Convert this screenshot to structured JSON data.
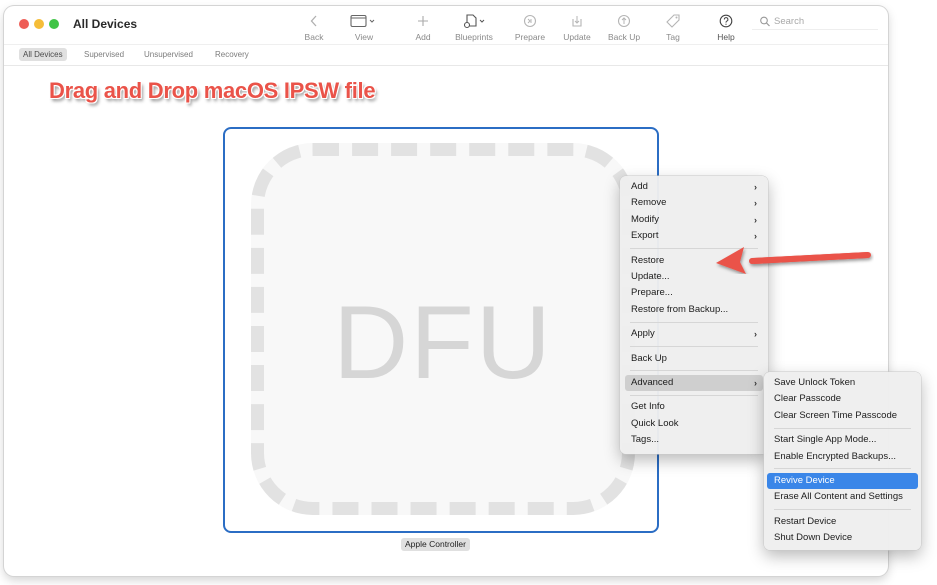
{
  "window": {
    "title": "All Devices"
  },
  "toolbar": {
    "buttons": [
      {
        "label": "Back",
        "icon": "chevron-left-icon"
      },
      {
        "label": "View",
        "icon": "window-view-icon"
      },
      {
        "label": "Add",
        "icon": "plus-icon"
      },
      {
        "label": "Blueprints",
        "icon": "blueprints-icon"
      },
      {
        "label": "Prepare",
        "icon": "prepare-icon"
      },
      {
        "label": "Update",
        "icon": "update-icon"
      },
      {
        "label": "Back Up",
        "icon": "backup-icon"
      },
      {
        "label": "Tag",
        "icon": "tag-icon"
      },
      {
        "label": "Help",
        "icon": "help-icon"
      }
    ],
    "search_placeholder": "Search"
  },
  "filters": {
    "items": [
      "All Devices",
      "Supervised",
      "Unsupervised",
      "Recovery"
    ],
    "active": "All Devices"
  },
  "annotation": {
    "title": "Drag and Drop macOS IPSW file",
    "arrow_color": "#ea5349",
    "points_to": "Restore"
  },
  "device": {
    "mode_text": "DFU",
    "name": "Apple Controller"
  },
  "context_menu": {
    "groups": [
      [
        {
          "label": "Add",
          "submenu": true
        },
        {
          "label": "Remove",
          "submenu": true
        },
        {
          "label": "Modify",
          "submenu": true
        },
        {
          "label": "Export",
          "submenu": true
        }
      ],
      [
        {
          "label": "Restore"
        },
        {
          "label": "Update..."
        },
        {
          "label": "Prepare..."
        },
        {
          "label": "Restore from Backup..."
        }
      ],
      [
        {
          "label": "Apply",
          "submenu": true
        }
      ],
      [
        {
          "label": "Back Up"
        }
      ],
      [
        {
          "label": "Advanced",
          "submenu": true,
          "highlighted": true
        }
      ],
      [
        {
          "label": "Get Info"
        },
        {
          "label": "Quick Look"
        },
        {
          "label": "Tags..."
        }
      ]
    ]
  },
  "advanced_submenu": {
    "groups": [
      [
        {
          "label": "Save Unlock Token"
        },
        {
          "label": "Clear Passcode"
        },
        {
          "label": "Clear Screen Time Passcode"
        }
      ],
      [
        {
          "label": "Start Single App Mode..."
        },
        {
          "label": "Enable Encrypted Backups..."
        }
      ],
      [
        {
          "label": "Revive Device",
          "selected": true
        },
        {
          "label": "Erase All Content and Settings"
        }
      ],
      [
        {
          "label": "Restart Device"
        },
        {
          "label": "Shut Down Device"
        }
      ]
    ]
  },
  "colors": {
    "accent": "#2b6dc4",
    "selection": "#3a86e8",
    "annotation_red": "#ea5349",
    "close": "#ee5d56",
    "minimize": "#f5bd38",
    "zoom": "#40c446"
  }
}
